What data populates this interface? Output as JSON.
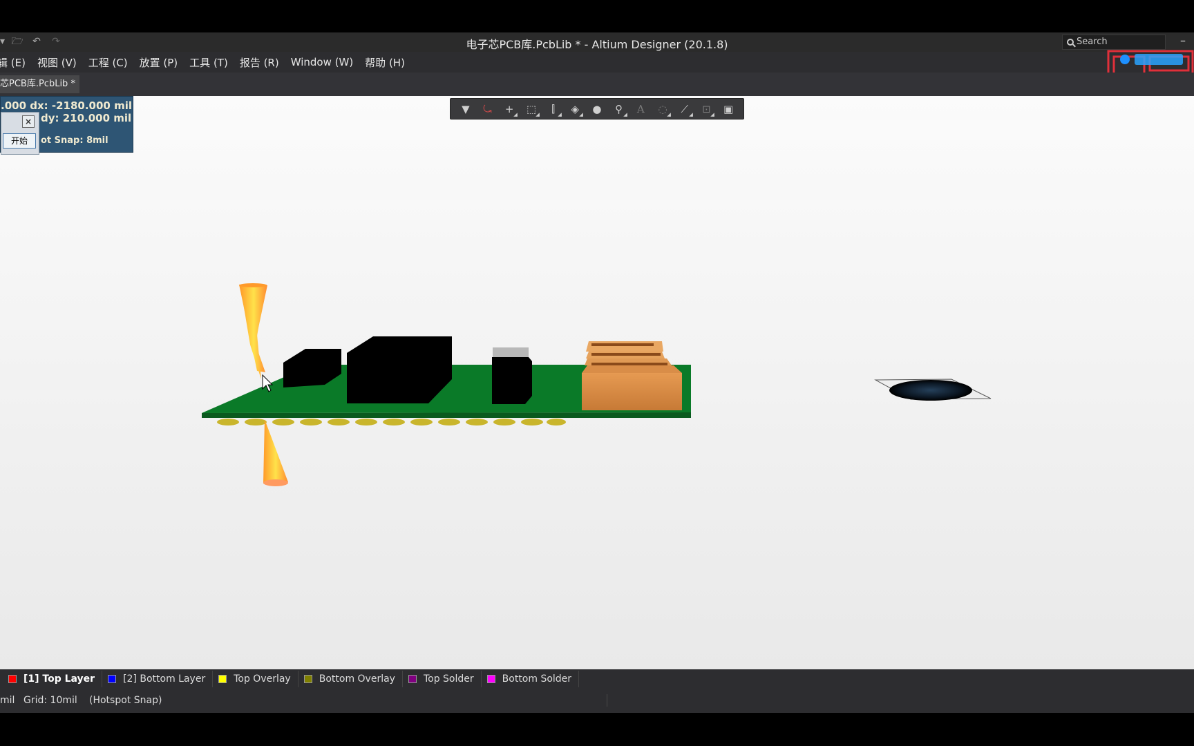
{
  "window": {
    "title": "电子芯PCB库.PcbLib * - Altium Designer (20.1.8)",
    "search_placeholder": "Search"
  },
  "quick_access": [
    "folder-open-icon",
    "undo-icon",
    "redo-icon"
  ],
  "menu": [
    "辑 (E)",
    "视图 (V)",
    "工程 (C)",
    "放置 (P)",
    "工具 (T)",
    "报告 (R)",
    "Window (W)",
    "帮助 (H)"
  ],
  "doc_tab": "芯PCB库.PcbLib *",
  "heads_up": {
    "line1": ".000   dx: -2180.000 mil",
    "line2": "dy:   210.000  mil",
    "line3": "ot Snap: 8mil",
    "close": "×",
    "start_button": "开始"
  },
  "toolbar": [
    "filter-icon",
    "route-icon",
    "crosshair-icon",
    "select-rect-icon",
    "align-icon",
    "layer-icon",
    "pad-icon",
    "via-icon",
    "text-icon",
    "arc-icon",
    "line-icon",
    "dimension-icon",
    "region-icon"
  ],
  "layers": [
    {
      "label": "[1] Top Layer",
      "color": "#ff0000",
      "active": true
    },
    {
      "label": "[2] Bottom Layer",
      "color": "#0000ff",
      "active": false
    },
    {
      "label": "Top Overlay",
      "color": "#ffff00",
      "active": false
    },
    {
      "label": "Bottom Overlay",
      "color": "#808000",
      "active": false
    },
    {
      "label": "Top Solder",
      "color": "#800080",
      "active": false
    },
    {
      "label": "Bottom Solder",
      "color": "#ff00ff",
      "active": false
    }
  ],
  "status": {
    "unit": "mil",
    "grid": "Grid: 10mil",
    "snap": "(Hotspot Snap)"
  }
}
